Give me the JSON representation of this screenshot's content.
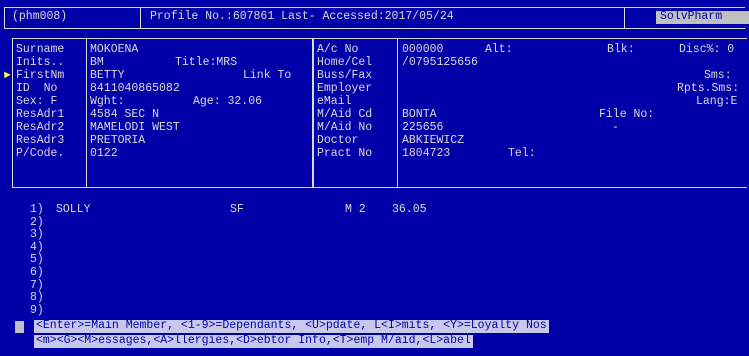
{
  "header": {
    "program_code": "(phm008)",
    "profile_line": "Profile No.:607861 Last- Accessed:2017/05/24",
    "app_name": "SolvPharm"
  },
  "patient_panel": {
    "surname_label": "Surname",
    "surname_value": "MOKOENA",
    "inits_label": "Inits..",
    "inits_value": "BM",
    "title_label": "Title:MRS",
    "firstname_label": "FirstNm",
    "firstname_value": "BETTY",
    "link_to_label": "Link To",
    "id_label": "ID  No",
    "id_value": "8411040865082",
    "sex_label": "Sex: F",
    "wght_label": "Wght:",
    "age_label": "Age: 32.06",
    "resadr1_label": "ResAdr1",
    "resadr1_value": "4584 SEC N",
    "resadr2_label": "ResAdr2",
    "resadr2_value": "MAMELODI WEST",
    "resadr3_label": "ResAdr3",
    "resadr3_value": "PRETORIA",
    "pcode_label": "P/Code.",
    "pcode_value": "0122"
  },
  "account_panel": {
    "ac_no_label": "A/c No",
    "ac_no_value": "000000",
    "alt_label": "Alt:",
    "home_cel_label": "Home/Cel",
    "home_cel_value": "/0795125656",
    "buss_fax_label": "Buss/Fax",
    "employer_label": "Employer",
    "email_label": "eMail",
    "maid_cd_label": "M/Aid Cd",
    "maid_cd_value": "BONTA",
    "maid_no_label": "M/Aid No",
    "maid_no_value": "225656",
    "doctor_label": "Doctor",
    "doctor_value": "ABKIEWICZ",
    "pract_no_label": "Pract No",
    "pract_no_value": "1804723",
    "tel_label": "Tel:"
  },
  "right_panel": {
    "blk_label": "Blk:",
    "disc_label": "Disc%: 0",
    "sms_label": "Sms:",
    "rpts_sms_label": "Rpts.Sms:",
    "lang_label": "Lang:E",
    "file_no_label": "File No:",
    "dash": "-"
  },
  "dependants": [
    {
      "num": "1)",
      "name": "SOLLY",
      "code": "SF",
      "rel": "M 2",
      "age": "36.05"
    },
    {
      "num": "2)",
      "name": "",
      "code": "",
      "rel": "",
      "age": ""
    },
    {
      "num": "3)",
      "name": "",
      "code": "",
      "rel": "",
      "age": ""
    },
    {
      "num": "4)",
      "name": "",
      "code": "",
      "rel": "",
      "age": ""
    },
    {
      "num": "5)",
      "name": "",
      "code": "",
      "rel": "",
      "age": ""
    },
    {
      "num": "6)",
      "name": "",
      "code": "",
      "rel": "",
      "age": ""
    },
    {
      "num": "7)",
      "name": "",
      "code": "",
      "rel": "",
      "age": ""
    },
    {
      "num": "8)",
      "name": "",
      "code": "",
      "rel": "",
      "age": ""
    },
    {
      "num": "9)",
      "name": "",
      "code": "",
      "rel": "",
      "age": ""
    }
  ],
  "prompt": {
    "line1": "<Enter>=Main Member, <1-9>=Dependants, <U>pdate, L<I>mits, <Y>=Loyalty Nos",
    "line2": "<m><G><M>essages,<A>llergies,<D>ebtor Info,<T>emp M/aid,<L>abel"
  },
  "colors": {
    "background": "#0000a8",
    "foreground": "#d8d8d8",
    "highlight": "#c0c0c0",
    "pointer": "#ffff55"
  }
}
